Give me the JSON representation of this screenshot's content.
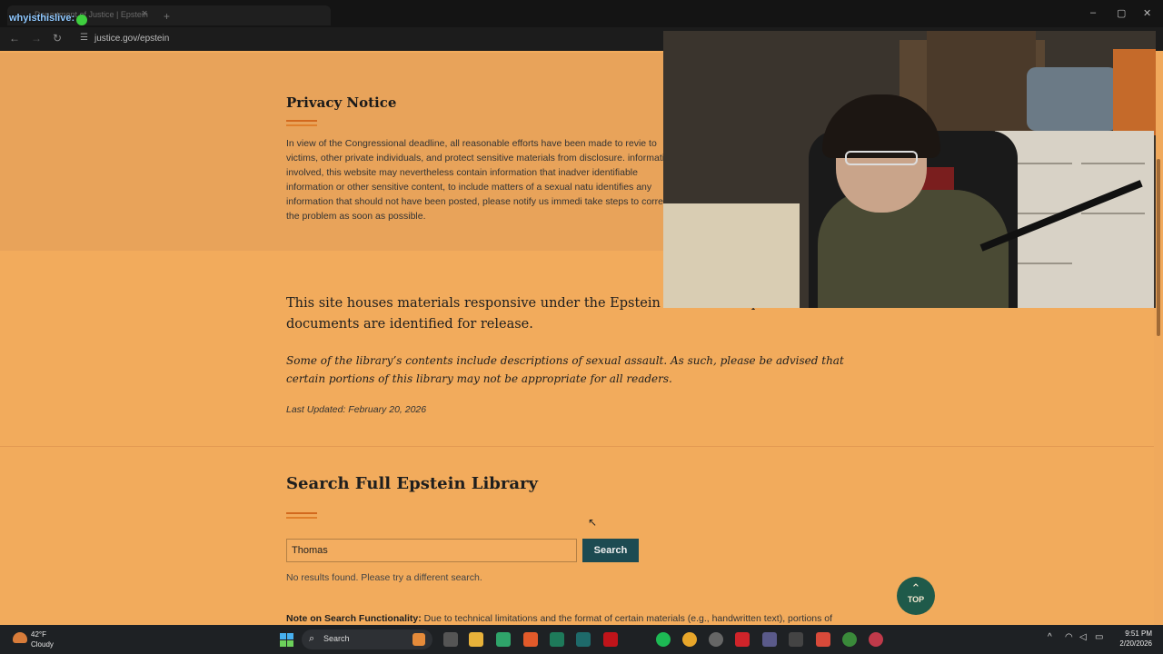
{
  "browser": {
    "tab_title": "Department of Justice | Epstein",
    "tab_close": "×",
    "new_tab": "+",
    "url": "justice.gov/epstein",
    "window_controls": [
      "–",
      "▢",
      "✕"
    ]
  },
  "stream_overlay": {
    "channel": "whyisthislive:"
  },
  "privacy": {
    "title": "Privacy Notice",
    "body": "In view of the Congressional deadline, all reasonable efforts have been made to revie to victims, other private individuals, and protect sensitive materials from disclosure. information involved, this website may nevertheless contain information that inadver identifiable information or other sensitive content, to include matters of a sexual natu identifies any information that should not have been posted, please notify us immedi take steps to correct the problem as soon as possible."
  },
  "intro": {
    "lead": "This site houses materials responsive under the Epstein File will be updated if additional documents are identified for release.",
    "warning": "Some of the library’s contents include descriptions of sexual assault. As such, please be advised that certain portions of this library may not be appropriate for all readers.",
    "updated": "Last Updated: February 20, 2026"
  },
  "search": {
    "title": "Search Full Epstein Library",
    "input_value": "Thomas",
    "button_label": "Search",
    "no_results": "No results found. Please try a different search.",
    "note_label": "Note on Search Functionality:",
    "note_text": " Due to technical limitations and the format of certain materials (e.g., handwritten text), portions of"
  },
  "back_to_top": {
    "arrow": "⌃",
    "label": "TOP"
  },
  "taskbar": {
    "temperature": "42°F",
    "condition": "Cloudy",
    "search_label": "Search",
    "time": "9:51 PM",
    "date": "2/20/2026"
  },
  "colors": {
    "page_bg": "#f2ab5c",
    "accent": "#d2691e",
    "search_button": "#1d4b52",
    "top_button": "#1f5a4a"
  }
}
